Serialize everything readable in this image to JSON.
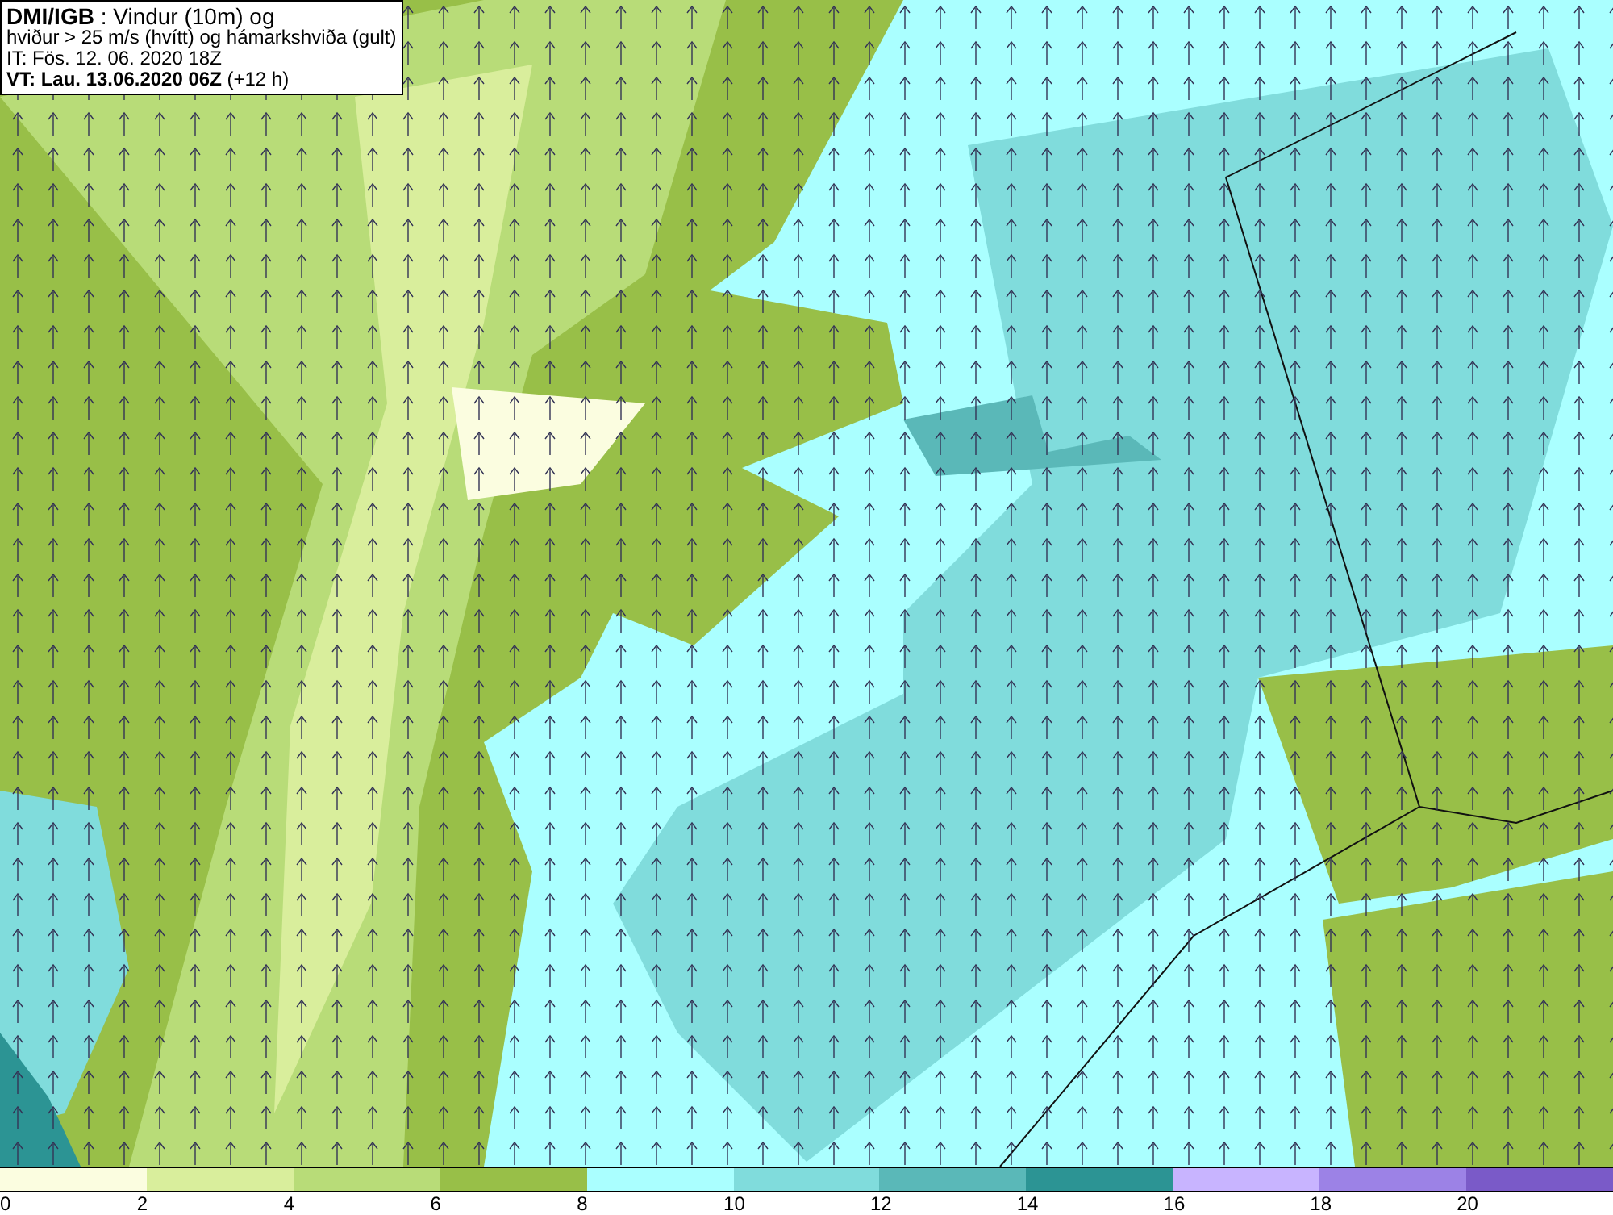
{
  "info_box": {
    "lines": [
      "**DMI/IGB** : Vindur (10m) og",
      "hviður > 25 m/s (hvítt) og hámarkshviða (gult)",
      "IT: Fös. 12. 06. 2020 18Z",
      "**VT: Lau. 13.06.2020 06Z** (+12 h)"
    ]
  },
  "legend": {
    "segments": [
      {
        "color": "#fbfde0"
      },
      {
        "color": "#d9ee9c"
      },
      {
        "color": "#b8dc78"
      },
      {
        "color": "#98bf48"
      },
      {
        "color": "#aaffff"
      },
      {
        "color": "#80dcdc"
      },
      {
        "color": "#5ab8b8"
      },
      {
        "color": "#2c9494"
      },
      {
        "color": "#c8b4ff"
      },
      {
        "color": "#9c82e6"
      },
      {
        "color": "#7a5ac8"
      }
    ],
    "ticks": [
      "0",
      "2",
      "4",
      "6",
      "8",
      "10",
      "12",
      "14",
      "16",
      "18",
      "20"
    ]
  }
}
